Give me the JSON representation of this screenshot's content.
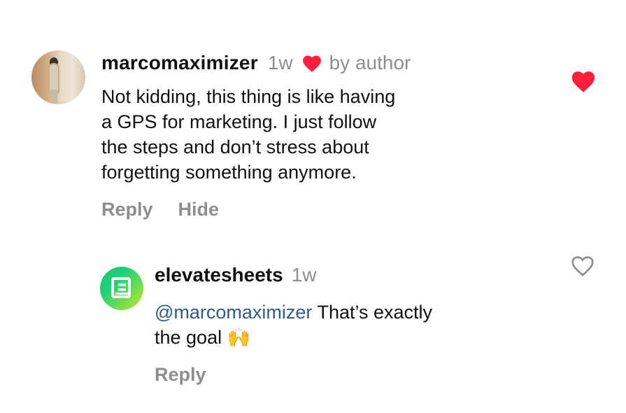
{
  "comment": {
    "username": "marcomaximizer",
    "time": "1w",
    "liked_by_author_label": "by author",
    "text_lines": [
      "Not kidding, this thing is like having",
      "a GPS for marketing. I just follow",
      "the steps and don’t stress about",
      "forgetting something anymore."
    ],
    "actions": {
      "reply": "Reply",
      "hide": "Hide"
    },
    "liked": true,
    "icons": {
      "author_heart": "filled-heart-icon",
      "like": "filled-heart-icon"
    }
  },
  "reply": {
    "username": "elevatesheets",
    "time": "1w",
    "mention": "@marcomaximizer",
    "text_after_mention": " That’s exactly",
    "text_line2": "the goal",
    "emoji": "🙌",
    "actions": {
      "reply": "Reply"
    },
    "liked": false,
    "icons": {
      "like": "outline-heart-icon",
      "avatar": "sheet-logo-icon"
    }
  },
  "colors": {
    "heart_red": "#ff1f3d",
    "meta_gray": "#8e8e8e",
    "mention_blue": "#2f5b8c",
    "text": "#111111",
    "avatar_gradient_start": "#14c96a",
    "avatar_gradient_end": "#b3ea34"
  }
}
